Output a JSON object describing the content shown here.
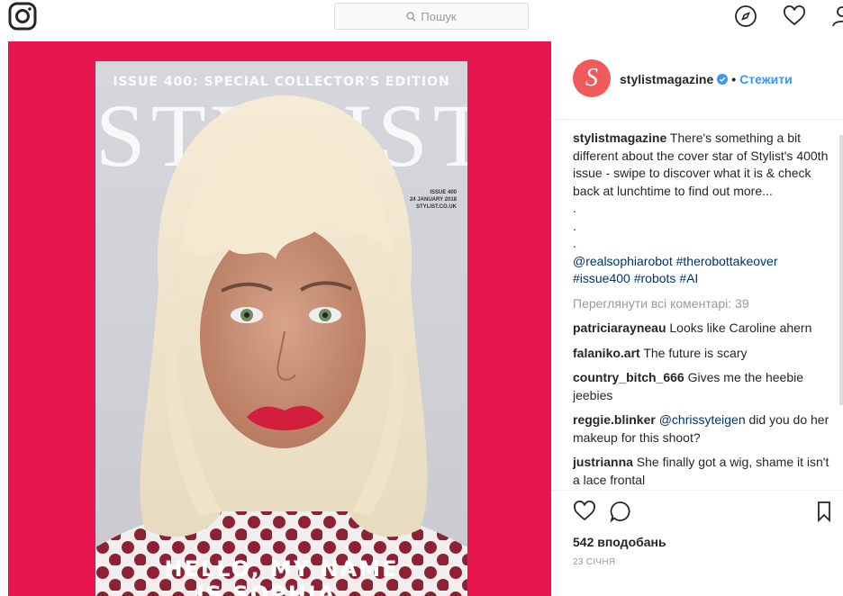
{
  "topbar": {
    "logo_icon": "instagram-logo-icon",
    "search_placeholder": "Пошук",
    "nav_icons": [
      "compass-icon",
      "heart-icon",
      "profile-icon"
    ]
  },
  "photo": {
    "background_color": "#e8154f",
    "cover": {
      "issue_line": "ISSUE 400: SPECIAL COLLECTOR'S EDITION",
      "masthead": "STYLIST",
      "meta_issue": "ISSUE 400",
      "meta_date": "24 JANUARY 2018",
      "meta_site": "STYLIST.CO.UK",
      "headline_line1": "HELLO, MY NAME",
      "headline_line2": "IS SOPHIA..."
    }
  },
  "post": {
    "username": "stylistmagazine",
    "avatar_letter": "S",
    "avatar_color": "#f05a5b",
    "dot": "•",
    "follow_label": "Стежити",
    "caption_text": "There's something a bit different about the cover star of Stylist's 400th issue - swipe to discover what it is & check back at lunchtime to find out more...",
    "caption_dots": [
      ".",
      ".",
      "."
    ],
    "caption_tags": [
      "@realsophiarobot",
      "#therobottakeover",
      "#issue400",
      "#robots",
      "#AI"
    ],
    "view_all_comments": "Переглянути всі коментарі: 39",
    "comments": [
      {
        "user": "patriciarayneau",
        "text": "Looks like Caroline ahern"
      },
      {
        "user": "falaniko.art",
        "text": "The future is scary"
      },
      {
        "user": "country_bitch_666",
        "text": "Gives me the heebie jeebies"
      },
      {
        "user": "reggie.blinker",
        "mention": "@chrissyteigen",
        "text": "did you do her makeup for this shoot?"
      },
      {
        "user": "justrianna",
        "text": "She finally got a wig, shame it isn't a lace frontal"
      }
    ],
    "likes": "542 вподобань",
    "date": "23 СІЧНЯ",
    "action_icons": [
      "heart-icon",
      "comment-icon",
      "bookmark-icon"
    ],
    "link_color": "#003569",
    "accent_color": "#3897f0"
  }
}
